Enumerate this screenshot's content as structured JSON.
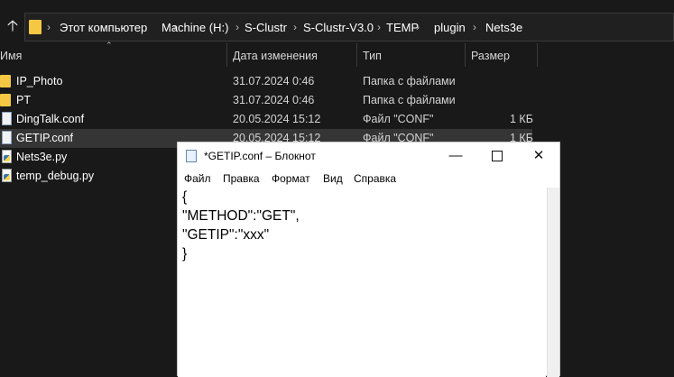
{
  "explorer": {
    "breadcrumb": [
      "Этот компьютер",
      "Machine (H:)",
      "S-Clustr",
      "S-Clustr-V3.0",
      "TEMP",
      "plugin",
      "Nets3e"
    ],
    "columns": {
      "name": "Имя",
      "date": "Дата изменения",
      "type": "Тип",
      "size": "Размер"
    },
    "files": [
      {
        "name": "IP_Photo",
        "date": "31.07.2024 0:46",
        "type": "Папка с файлами",
        "size": "",
        "icon": "folder-icon"
      },
      {
        "name": "PT",
        "date": "31.07.2024 0:46",
        "type": "Папка с файлами",
        "size": "",
        "icon": "folder-icon"
      },
      {
        "name": "DingTalk.conf",
        "date": "20.05.2024 15:12",
        "type": "Файл \"CONF\"",
        "size": "1 КБ",
        "icon": "text-file-icon"
      },
      {
        "name": "GETIP.conf",
        "date": "20.05.2024 15:12",
        "type": "Файл \"CONF\"",
        "size": "1 КБ",
        "icon": "text-file-icon"
      },
      {
        "name": "Nets3e.py",
        "date": "",
        "type": "",
        "size": "",
        "icon": "python-file-icon"
      },
      {
        "name": "temp_debug.py",
        "date": "",
        "type": "",
        "size": "",
        "icon": "python-file-icon"
      }
    ]
  },
  "notepad": {
    "title": "*GETIP.conf – Блокнот",
    "menu": [
      "Файл",
      "Правка",
      "Формат",
      "Вид",
      "Справка"
    ],
    "lines": [
      "{",
      "\"METHOD\":\"GET\",",
      "\"GETIP\":\"xxx\"",
      "}"
    ]
  },
  "colors": {
    "explorer_bg": "#191919",
    "folder": "#f4c842",
    "selected_row": "#353535",
    "notepad_bg": "#ffffff"
  }
}
